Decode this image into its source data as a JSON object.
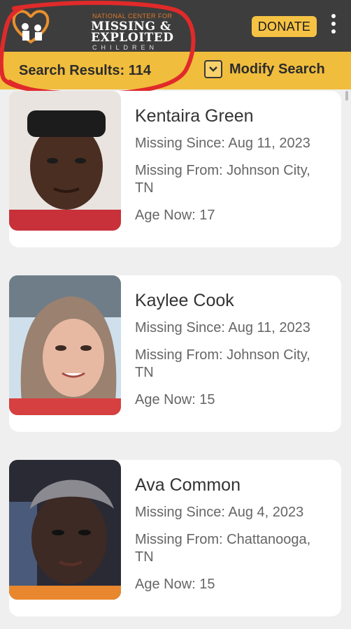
{
  "header": {
    "logo_small": "NATIONAL CENTER FOR",
    "logo_line1": "MISSING &",
    "logo_line2": "EXPLOITED",
    "logo_children": "CHILDREN",
    "donate_label": "DONATE",
    "menu_icon": "kebab-menu-icon"
  },
  "subheader": {
    "results_label": "Search Results: 114",
    "modify_label": "Modify Search",
    "modify_icon": "chevron-down-icon"
  },
  "annotation": {
    "color": "#e02a2a"
  },
  "colors": {
    "topbar": "#3d3d3d",
    "accent": "#f0bd3d",
    "donate": "#f5c244",
    "card": "#ffffff",
    "page": "#efefef"
  },
  "cards": [
    {
      "name": "Kentaira Green",
      "missing_since": "Missing Since: Aug 11, 2023",
      "missing_from_1": "Missing From: Johnson City,",
      "missing_from_2": "TN",
      "age_now": "Age Now: 17"
    },
    {
      "name": "Kaylee Cook",
      "missing_since": "Missing Since: Aug 11, 2023",
      "missing_from_1": "Missing From: Johnson City,",
      "missing_from_2": "TN",
      "age_now": "Age Now: 15"
    },
    {
      "name": "Ava Common",
      "missing_since": "Missing Since: Aug 4, 2023",
      "missing_from_1": "Missing From: Chattanooga,",
      "missing_from_2": "TN",
      "age_now": "Age Now: 15"
    }
  ]
}
